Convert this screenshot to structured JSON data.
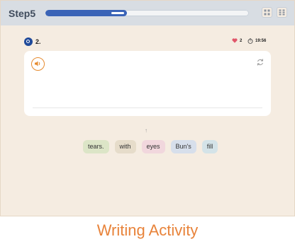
{
  "header": {
    "step_label": "Step5",
    "progress": 0.4
  },
  "question": {
    "number_label": "2.",
    "hearts": "2",
    "timer": "19:56"
  },
  "word_chips": [
    {
      "text": "tears.",
      "color": "#dce5c7"
    },
    {
      "text": "with",
      "color": "#e6dcca"
    },
    {
      "text": "eyes",
      "color": "#f1d7dd"
    },
    {
      "text": "Bun's",
      "color": "#d7dfeb"
    },
    {
      "text": "fill",
      "color": "#d4e3e8"
    }
  ],
  "footer": {
    "title": "Writing Activity"
  },
  "colors": {
    "accent": "#e8833a",
    "progress": "#3a63b7",
    "question_icon": "#1f4a9a"
  },
  "icons": {
    "audio": "speaker-icon",
    "refresh": "refresh-icon",
    "heart": "heart-icon",
    "timer": "stopwatch-icon",
    "grid": "grid-icon",
    "list": "list-icon",
    "arrow": "arrow-up-icon"
  }
}
